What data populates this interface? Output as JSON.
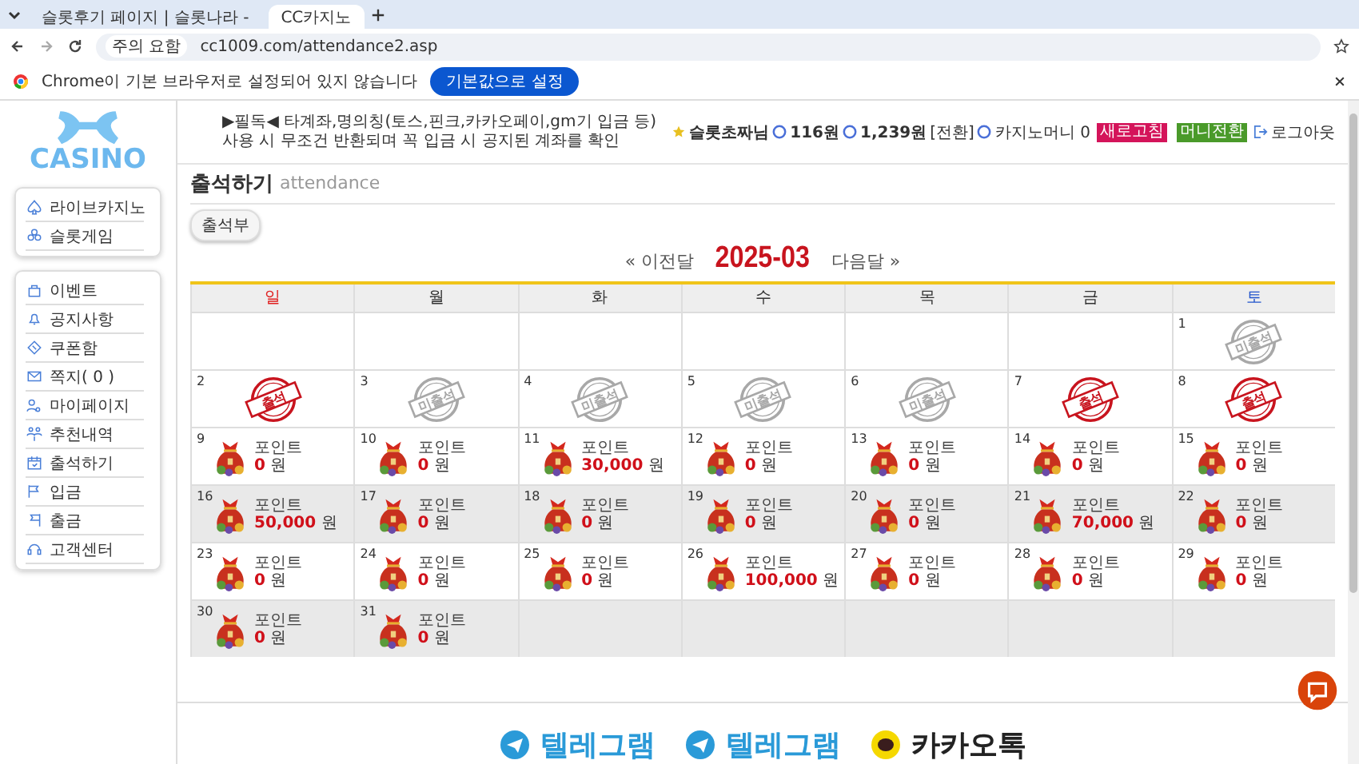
{
  "browser": {
    "tabs": [
      {
        "title": "슬롯후기 페이지 | 슬롯나라 -",
        "selected": false
      },
      {
        "title": "CC카지노",
        "selected": true
      }
    ],
    "security": "주의 요함",
    "url": "cc1009.com/attendance2.asp",
    "infobar": {
      "message": "Chrome이 기본 브라우저로 설정되어 있지 않습니다",
      "button": "기본값으로 설정"
    }
  },
  "sidebar": {
    "logo": "CASINO",
    "groups": [
      [
        "라이브카지노",
        "슬롯게임"
      ],
      [
        "이벤트",
        "공지사항",
        "쿠폰함",
        "쪽지( 0 )",
        "마이페이지",
        "추천내역",
        "출석하기",
        "입금",
        "출금",
        "고객센터"
      ]
    ]
  },
  "notice": "▶필독◀ 타계좌,명의칭(토스,핀크,카카오페이,gm기 입금 등)사용 시 무조건 반환되며 꼭 입금 시 공지된 계좌를 확인",
  "user": {
    "name": "슬롯초짜님",
    "balance": "116원",
    "points": "1,239원",
    "convert": "[전환]",
    "casino_money": "카지노머니 0",
    "badges": [
      {
        "label": "새로고침",
        "color": "#d4145a"
      },
      {
        "label": "머니전환",
        "color": "#4a9a2a"
      }
    ],
    "logout": "로그아웃"
  },
  "page": {
    "title": "출석하기",
    "subtitle": "attendance",
    "button": "출석부",
    "prev": "« 이전달",
    "month": "2025-03",
    "next": "다음달 »"
  },
  "calendar": {
    "headers": [
      {
        "label": "일",
        "color": "#e02020"
      },
      {
        "label": "월",
        "color": "#333333"
      },
      {
        "label": "화",
        "color": "#333333"
      },
      {
        "label": "수",
        "color": "#333333"
      },
      {
        "label": "목",
        "color": "#333333"
      },
      {
        "label": "금",
        "color": "#333333"
      },
      {
        "label": "토",
        "color": "#2255cc"
      }
    ],
    "weeks": [
      {
        "shaded": false,
        "days": [
          {
            "kind": "empty"
          },
          {
            "kind": "empty"
          },
          {
            "kind": "empty"
          },
          {
            "kind": "empty"
          },
          {
            "kind": "empty"
          },
          {
            "kind": "empty"
          },
          {
            "kind": "stamp",
            "day": "1",
            "attended": false,
            "stamp": "미출석"
          }
        ]
      },
      {
        "shaded": false,
        "days": [
          {
            "kind": "stamp",
            "day": "2",
            "attended": true,
            "stamp": "출석"
          },
          {
            "kind": "stamp",
            "day": "3",
            "attended": false,
            "stamp": "미출석"
          },
          {
            "kind": "stamp",
            "day": "4",
            "attended": false,
            "stamp": "미출석"
          },
          {
            "kind": "stamp",
            "day": "5",
            "attended": false,
            "stamp": "미출석"
          },
          {
            "kind": "stamp",
            "day": "6",
            "attended": false,
            "stamp": "미출석"
          },
          {
            "kind": "stamp",
            "day": "7",
            "attended": true,
            "stamp": "출석"
          },
          {
            "kind": "stamp",
            "day": "8",
            "attended": true,
            "stamp": "출석"
          }
        ]
      },
      {
        "shaded": false,
        "days": [
          {
            "kind": "points",
            "day": "9",
            "label": "포인트",
            "amount": "0",
            "unit": "원"
          },
          {
            "kind": "points",
            "day": "10",
            "label": "포인트",
            "amount": "0",
            "unit": "원"
          },
          {
            "kind": "points",
            "day": "11",
            "label": "포인트",
            "amount": "30,000",
            "unit": "원"
          },
          {
            "kind": "points",
            "day": "12",
            "label": "포인트",
            "amount": "0",
            "unit": "원"
          },
          {
            "kind": "points",
            "day": "13",
            "label": "포인트",
            "amount": "0",
            "unit": "원"
          },
          {
            "kind": "points",
            "day": "14",
            "label": "포인트",
            "amount": "0",
            "unit": "원"
          },
          {
            "kind": "points",
            "day": "15",
            "label": "포인트",
            "amount": "0",
            "unit": "원"
          }
        ]
      },
      {
        "shaded": true,
        "days": [
          {
            "kind": "points",
            "day": "16",
            "label": "포인트",
            "amount": "50,000",
            "unit": "원"
          },
          {
            "kind": "points",
            "day": "17",
            "label": "포인트",
            "amount": "0",
            "unit": "원"
          },
          {
            "kind": "points",
            "day": "18",
            "label": "포인트",
            "amount": "0",
            "unit": "원"
          },
          {
            "kind": "points",
            "day": "19",
            "label": "포인트",
            "amount": "0",
            "unit": "원"
          },
          {
            "kind": "points",
            "day": "20",
            "label": "포인트",
            "amount": "0",
            "unit": "원"
          },
          {
            "kind": "points",
            "day": "21",
            "label": "포인트",
            "amount": "70,000",
            "unit": "원"
          },
          {
            "kind": "points",
            "day": "22",
            "label": "포인트",
            "amount": "0",
            "unit": "원"
          }
        ]
      },
      {
        "shaded": false,
        "days": [
          {
            "kind": "points",
            "day": "23",
            "label": "포인트",
            "amount": "0",
            "unit": "원"
          },
          {
            "kind": "points",
            "day": "24",
            "label": "포인트",
            "amount": "0",
            "unit": "원"
          },
          {
            "kind": "points",
            "day": "25",
            "label": "포인트",
            "amount": "0",
            "unit": "원"
          },
          {
            "kind": "points",
            "day": "26",
            "label": "포인트",
            "amount": "100,000",
            "unit": "원"
          },
          {
            "kind": "points",
            "day": "27",
            "label": "포인트",
            "amount": "0",
            "unit": "원"
          },
          {
            "kind": "points",
            "day": "28",
            "label": "포인트",
            "amount": "0",
            "unit": "원"
          },
          {
            "kind": "points",
            "day": "29",
            "label": "포인트",
            "amount": "0",
            "unit": "원"
          }
        ]
      },
      {
        "shaded": true,
        "days": [
          {
            "kind": "points",
            "day": "30",
            "label": "포인트",
            "amount": "0",
            "unit": "원"
          },
          {
            "kind": "points",
            "day": "31",
            "label": "포인트",
            "amount": "0",
            "unit": "원"
          },
          {
            "kind": "empty"
          },
          {
            "kind": "empty"
          },
          {
            "kind": "empty"
          },
          {
            "kind": "empty"
          },
          {
            "kind": "empty"
          }
        ]
      }
    ]
  },
  "footer": [
    {
      "label": "텔레그램",
      "kind": "telegram"
    },
    {
      "label": "텔레그램",
      "kind": "telegram"
    },
    {
      "label": "카카오톡",
      "kind": "kakao"
    }
  ]
}
